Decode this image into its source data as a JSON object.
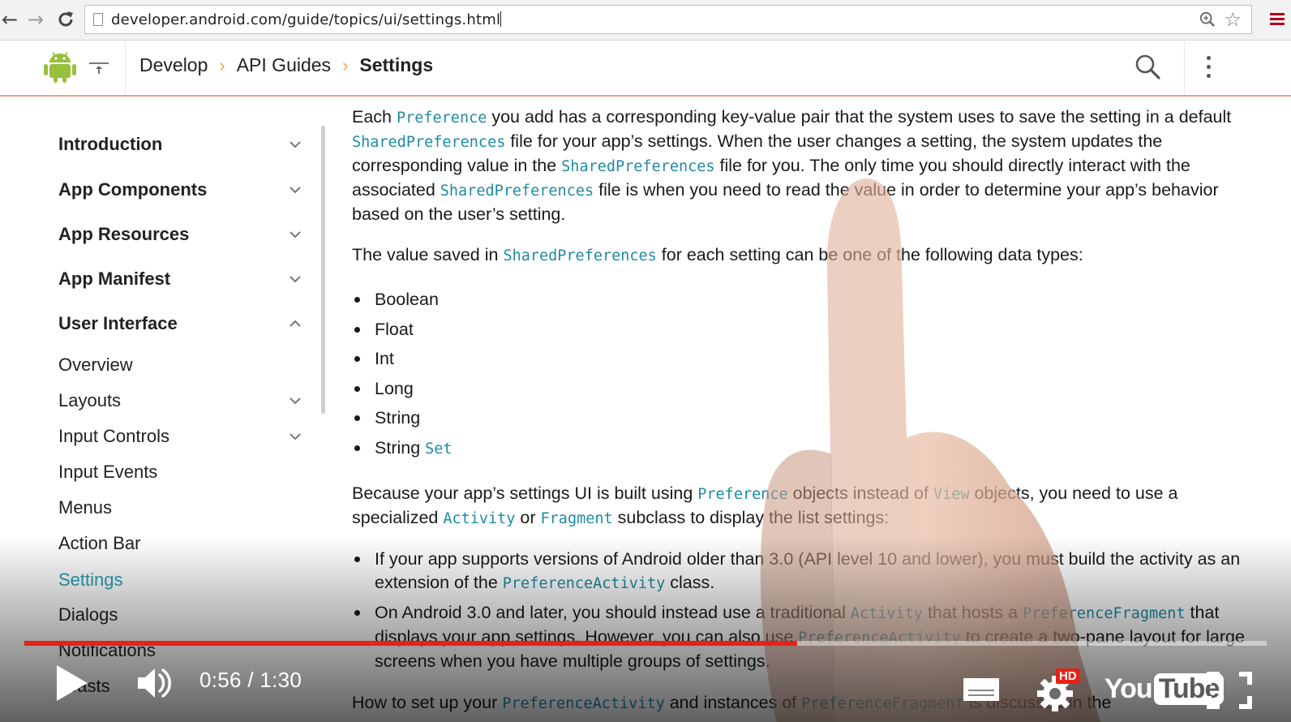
{
  "browser": {
    "url": "developer.android.com/guide/topics/ui/settings.html",
    "back_icon": "←",
    "forward_icon": "→",
    "reload_icon": "↻",
    "star_icon": "☆"
  },
  "header": {
    "breadcrumb": [
      "Develop",
      "API Guides",
      "Settings"
    ],
    "separator": "›"
  },
  "sidebar": {
    "items": [
      {
        "label": "Introduction",
        "bold": true,
        "chevron": "down"
      },
      {
        "label": "App Components",
        "bold": true,
        "chevron": "down"
      },
      {
        "label": "App Resources",
        "bold": true,
        "chevron": "down"
      },
      {
        "label": "App Manifest",
        "bold": true,
        "chevron": "down"
      },
      {
        "label": "User Interface",
        "bold": true,
        "chevron": "up"
      },
      {
        "label": "Overview",
        "bold": false,
        "chevron": ""
      },
      {
        "label": "Layouts",
        "bold": false,
        "chevron": "down"
      },
      {
        "label": "Input Controls",
        "bold": false,
        "chevron": "down"
      },
      {
        "label": "Input Events",
        "bold": false,
        "chevron": ""
      },
      {
        "label": "Menus",
        "bold": false,
        "chevron": ""
      },
      {
        "label": "Action Bar",
        "bold": false,
        "chevron": ""
      },
      {
        "label": "Settings",
        "bold": false,
        "chevron": "",
        "active": true
      },
      {
        "label": "Dialogs",
        "bold": false,
        "chevron": ""
      },
      {
        "label": "Notifications",
        "bold": false,
        "chevron": ""
      },
      {
        "label": "Toasts",
        "bold": false,
        "chevron": ""
      }
    ]
  },
  "content": {
    "p1": {
      "t1": "Each ",
      "c1": "Preference",
      "t2": " you add has a corresponding key-value pair that the system uses to save the setting in a default ",
      "c2": "SharedPreferences",
      "t3": " file for your app’s settings. When the user changes a setting, the system updates the corresponding value in the ",
      "c3": "SharedPreferences",
      "t4": " file for you. The only time you should directly interact with the associated ",
      "c4": "SharedPreferences",
      "t5": " file is when you need to read the value in order to determine your app’s behavior based on the user’s setting."
    },
    "p2": {
      "t1": "The value saved in ",
      "c1": "SharedPreferences",
      "t2": " for each setting can be one of the following data types:"
    },
    "types": [
      "Boolean",
      "Float",
      "Int",
      "Long",
      "String"
    ],
    "type_last": {
      "t1": "String ",
      "c1": "Set"
    },
    "p3": {
      "t1": "Because your app’s settings UI is built using ",
      "c1": "Preference",
      "t2": " objects instead of ",
      "c2": "View",
      "t3": " objects, you need to use a specialized ",
      "c3": "Activity",
      "t4": " or ",
      "c4": "Fragment",
      "t5": " subclass to display the list settings:"
    },
    "li1": {
      "t1": "If your app supports versions of Android older than 3.0 (API level 10 and lower), you must build the activity as an extension of the ",
      "c1": "PreferenceActivity",
      "t2": " class."
    },
    "li2": {
      "t1": "On Android 3.0 and later, you should instead use a traditional ",
      "c1": "Activity",
      "t2": " that hosts a ",
      "c2": "PreferenceFragment",
      "t3": " that displays your app settings. However, you can also use ",
      "c3": "PreferenceActivity",
      "t4": " to create a two-pane layout for large screens when you have multiple groups of settings."
    },
    "p4": {
      "t1": "How to set up your ",
      "c1": "PreferenceActivity",
      "t2": " and instances of ",
      "c2": "PreferenceFragment",
      "t3": " is discussed in the"
    }
  },
  "player": {
    "current_time": "0:56",
    "duration": "1:30",
    "time_text": "0:56 / 1:30",
    "progress": 0.622,
    "hd_label": "HD",
    "logo_you": "You",
    "logo_tube": "Tube",
    "progress_color": "#e62117"
  },
  "colors": {
    "code": "#1f8aa6",
    "active_nav": "#2a9fb3",
    "header_border": "#f3a37a",
    "breadcrumb_sep": "#f5a74a",
    "android_green": "#97c03d"
  }
}
